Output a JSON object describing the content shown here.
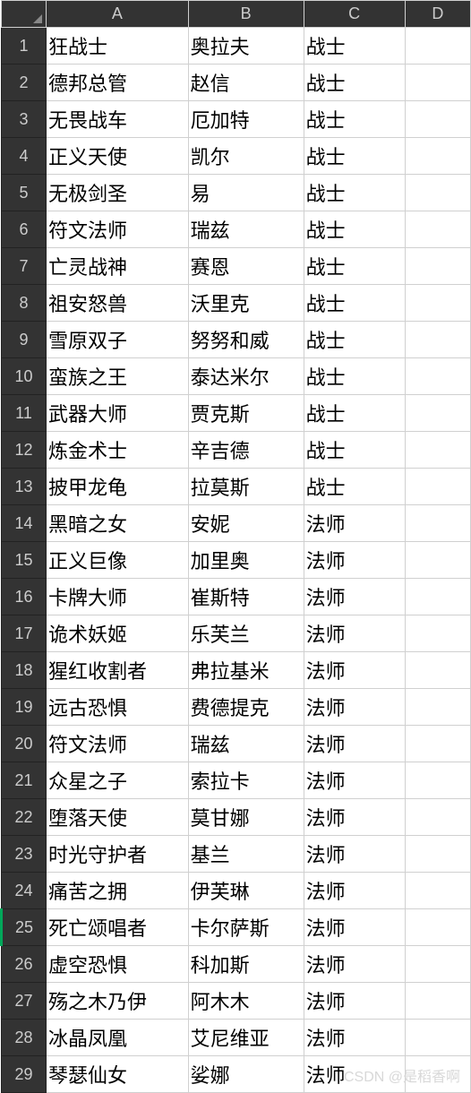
{
  "columns": [
    "A",
    "B",
    "C",
    "D"
  ],
  "selectedRow": 25,
  "rows": [
    {
      "n": 1,
      "a": "狂战士",
      "b": "奥拉夫",
      "c": "战士",
      "d": ""
    },
    {
      "n": 2,
      "a": "德邦总管",
      "b": "赵信",
      "c": "战士",
      "d": ""
    },
    {
      "n": 3,
      "a": "无畏战车",
      "b": "厄加特",
      "c": "战士",
      "d": ""
    },
    {
      "n": 4,
      "a": "正义天使",
      "b": "凯尔",
      "c": "战士",
      "d": ""
    },
    {
      "n": 5,
      "a": "无极剑圣",
      "b": "易",
      "c": "战士",
      "d": ""
    },
    {
      "n": 6,
      "a": "符文法师",
      "b": "瑞兹",
      "c": "战士",
      "d": ""
    },
    {
      "n": 7,
      "a": "亡灵战神",
      "b": "赛恩",
      "c": "战士",
      "d": ""
    },
    {
      "n": 8,
      "a": "祖安怒兽",
      "b": "沃里克",
      "c": "战士",
      "d": ""
    },
    {
      "n": 9,
      "a": "雪原双子",
      "b": "努努和威",
      "c": "战士",
      "d": ""
    },
    {
      "n": 10,
      "a": "蛮族之王",
      "b": "泰达米尔",
      "c": "战士",
      "d": ""
    },
    {
      "n": 11,
      "a": "武器大师",
      "b": "贾克斯",
      "c": "战士",
      "d": ""
    },
    {
      "n": 12,
      "a": "炼金术士",
      "b": "辛吉德",
      "c": "战士",
      "d": ""
    },
    {
      "n": 13,
      "a": "披甲龙龟",
      "b": "拉莫斯",
      "c": "战士",
      "d": ""
    },
    {
      "n": 14,
      "a": "黑暗之女",
      "b": "安妮",
      "c": "法师",
      "d": ""
    },
    {
      "n": 15,
      "a": "正义巨像",
      "b": "加里奥",
      "c": "法师",
      "d": ""
    },
    {
      "n": 16,
      "a": "卡牌大师",
      "b": "崔斯特",
      "c": "法师",
      "d": ""
    },
    {
      "n": 17,
      "a": "诡术妖姬",
      "b": "乐芙兰",
      "c": "法师",
      "d": ""
    },
    {
      "n": 18,
      "a": "猩红收割者",
      "b": "弗拉基米",
      "c": "法师",
      "d": ""
    },
    {
      "n": 19,
      "a": "远古恐惧",
      "b": "费德提克",
      "c": "法师",
      "d": ""
    },
    {
      "n": 20,
      "a": "符文法师",
      "b": "瑞兹",
      "c": "法师",
      "d": ""
    },
    {
      "n": 21,
      "a": "众星之子",
      "b": "索拉卡",
      "c": "法师",
      "d": ""
    },
    {
      "n": 22,
      "a": "堕落天使",
      "b": "莫甘娜",
      "c": "法师",
      "d": ""
    },
    {
      "n": 23,
      "a": "时光守护者",
      "b": "基兰",
      "c": "法师",
      "d": ""
    },
    {
      "n": 24,
      "a": "痛苦之拥",
      "b": "伊芙琳",
      "c": "法师",
      "d": ""
    },
    {
      "n": 25,
      "a": "死亡颂唱者",
      "b": "卡尔萨斯",
      "c": "法师",
      "d": ""
    },
    {
      "n": 26,
      "a": "虚空恐惧",
      "b": "科加斯",
      "c": "法师",
      "d": ""
    },
    {
      "n": 27,
      "a": "殇之木乃伊",
      "b": "阿木木",
      "c": "法师",
      "d": ""
    },
    {
      "n": 28,
      "a": "冰晶凤凰",
      "b": "艾尼维亚",
      "c": "法师",
      "d": ""
    },
    {
      "n": 29,
      "a": "琴瑟仙女",
      "b": "娑娜",
      "c": "法师",
      "d": ""
    }
  ],
  "watermark": "CSDN @是稻香啊"
}
